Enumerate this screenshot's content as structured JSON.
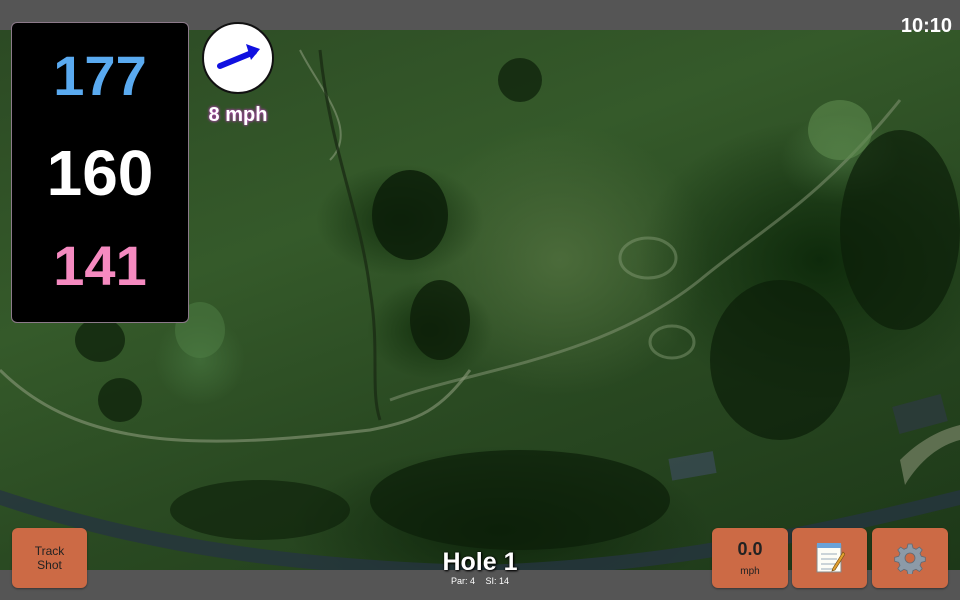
{
  "status_bar": {
    "time": "10:10"
  },
  "distances": {
    "back": "177",
    "center": "160",
    "front": "141"
  },
  "wind": {
    "speed_label": "8 mph",
    "direction_icon": "arrow-icon"
  },
  "hole": {
    "title": "Hole 1",
    "par_label": "Par: 4",
    "si_label": "SI: 14"
  },
  "buttons": {
    "track_shot_line1": "Track",
    "track_shot_line2": "Shot",
    "speed_value": "0.0",
    "speed_unit": "mph",
    "notes_icon": "notepad-icon",
    "settings_icon": "gear-icon"
  },
  "colors": {
    "back_distance": "#5aaaf0",
    "center_distance": "#ffffff",
    "front_distance": "#f58ac0",
    "button": "#cc6a45",
    "bar": "#555555"
  }
}
